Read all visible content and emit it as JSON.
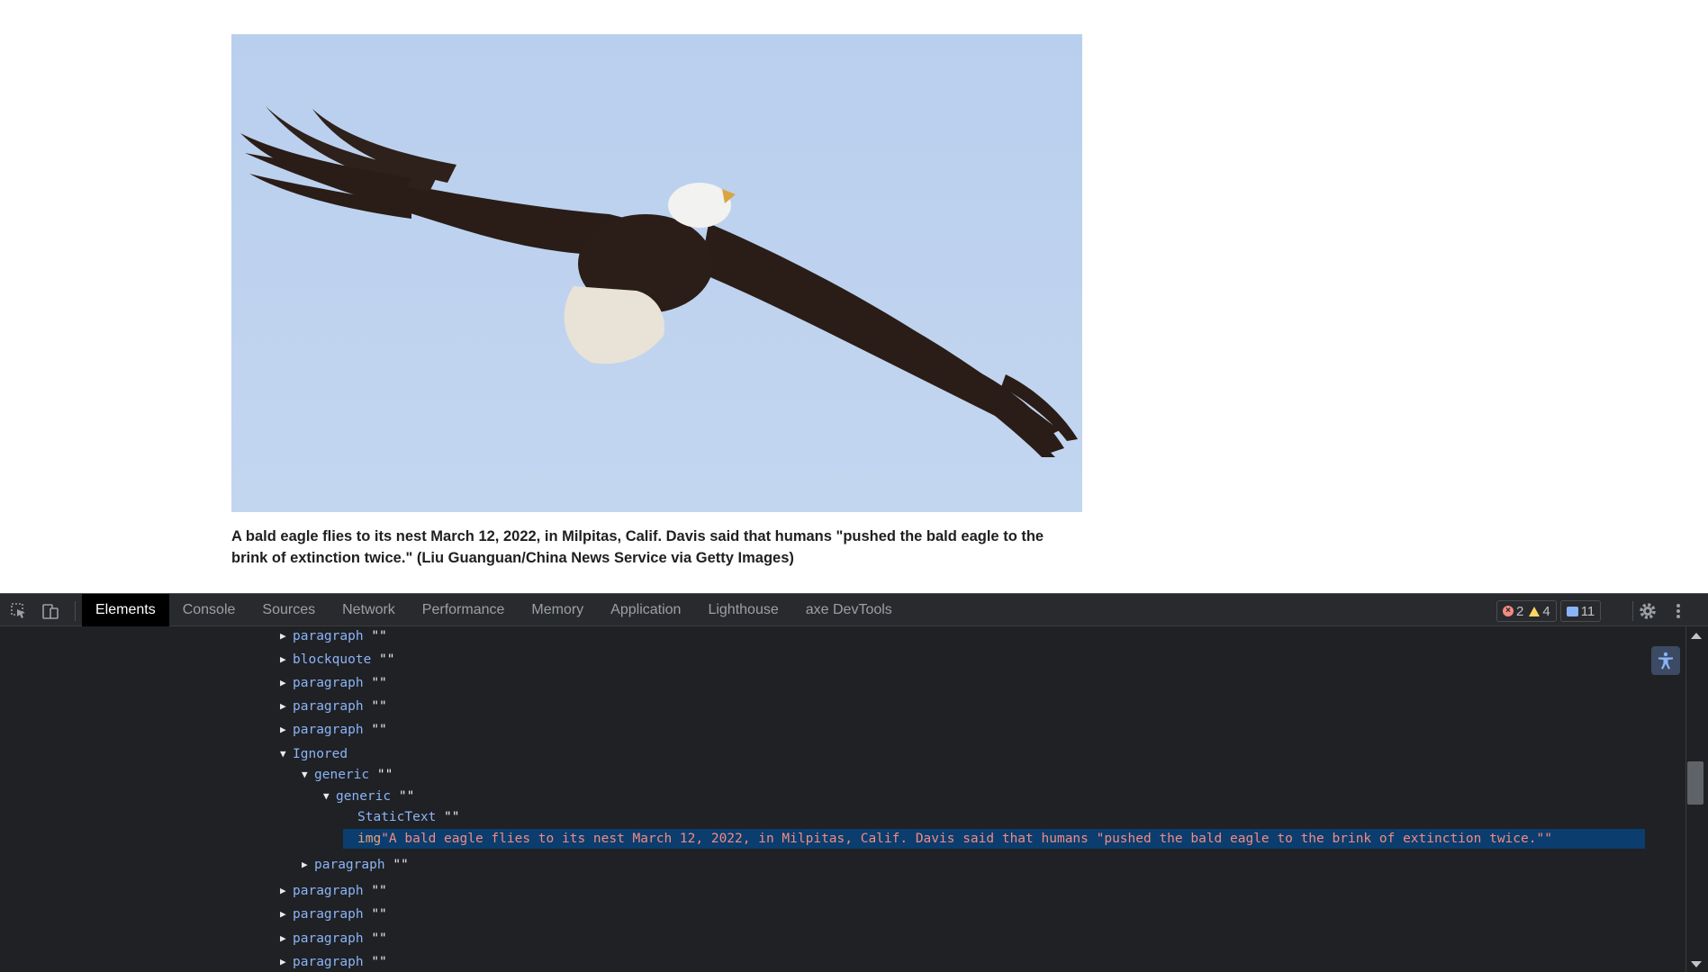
{
  "article": {
    "image_alt": "A bald eagle flies to its nest March 12, 2022, in Milpitas, Calif. Davis said that humans \"pushed the bald eagle to the brink of extinction twice.\"",
    "caption": "A bald eagle flies to its nest March 12, 2022, in Milpitas, Calif. Davis said that humans \"pushed the bald eagle to the brink of extinction twice.\" (Liu Guanguan/China News Service via Getty Images)"
  },
  "devtools": {
    "tabs": [
      {
        "label": "Elements",
        "active": true
      },
      {
        "label": "Console"
      },
      {
        "label": "Sources"
      },
      {
        "label": "Network"
      },
      {
        "label": "Performance"
      },
      {
        "label": "Memory"
      },
      {
        "label": "Application"
      },
      {
        "label": "Lighthouse"
      },
      {
        "label": "axe DevTools"
      }
    ],
    "badges": {
      "errors": "2",
      "warnings": "4",
      "messages": "11"
    },
    "colors": {
      "error": "#f28b82",
      "warning": "#fdd663",
      "info": "#8ab4f8",
      "selection": "#0b3d6e"
    },
    "tree": [
      {
        "name": "paragraph",
        "value": "\"\"",
        "expander": "▶"
      },
      {
        "name": "blockquote",
        "value": "\"\"",
        "expander": "▶"
      },
      {
        "name": "paragraph",
        "value": "\"\"",
        "expander": "▶"
      },
      {
        "name": "paragraph",
        "value": "\"\"",
        "expander": "▶"
      },
      {
        "name": "paragraph",
        "value": "\"\"",
        "expander": "▶"
      },
      {
        "name": "Ignored",
        "value": "",
        "expander": "▼"
      },
      {
        "name": "generic",
        "value": "\"\"",
        "expander": "▼"
      },
      {
        "name": "generic",
        "value": "\"\"",
        "expander": "▼"
      },
      {
        "name": "StaticText",
        "value": "\"\"",
        "expander": ""
      },
      {
        "name": "img",
        "value": "\"A bald eagle flies to its nest March 12, 2022, in Milpitas, Calif. Davis said that humans \"pushed the bald eagle to the brink of extinction twice.\"\"",
        "expander": "",
        "selected": true
      },
      {
        "name": "paragraph",
        "value": "\"\"",
        "expander": "▶"
      },
      {
        "name": "paragraph",
        "value": "\"\"",
        "expander": "▶"
      },
      {
        "name": "paragraph",
        "value": "\"\"",
        "expander": "▶"
      },
      {
        "name": "paragraph",
        "value": "\"\"",
        "expander": "▶"
      },
      {
        "name": "paragraph",
        "value": "\"\"",
        "expander": "▶"
      }
    ],
    "icons": [
      "inspect-element-icon",
      "device-toolbar-icon",
      "settings-gear-icon",
      "more-options-icon",
      "accessibility-icon"
    ]
  }
}
